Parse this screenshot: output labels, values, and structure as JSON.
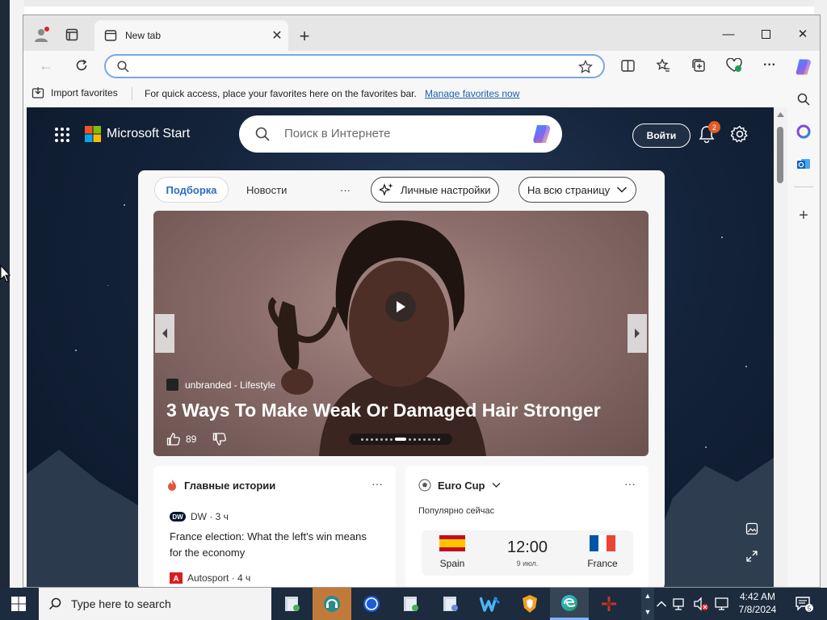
{
  "browser": {
    "tab_title": "New tab",
    "address": {
      "value": "",
      "placeholder": ""
    },
    "favorites_bar": {
      "import_label": "Import favorites",
      "message": "For quick access, place your favorites here on the favorites bar.",
      "manage_link": "Manage favorites now"
    }
  },
  "start_page": {
    "brand": "Microsoft Start",
    "search_placeholder": "Поиск в Интернете",
    "login_label": "Войти",
    "notification_count": "2",
    "feed_tabs": {
      "selected": "Подборка",
      "news": "Новости",
      "more": "···",
      "personalize": "Личные настройки",
      "layout": "На всю страницу"
    },
    "hero": {
      "source": "unbranded - Lifestyle",
      "title": "3 Ways To Make Weak Or Damaged Hair Stronger",
      "likes": "89"
    },
    "top_stories": {
      "heading": "Главные истории",
      "more": "···",
      "story1_source": "DW · 3 ч",
      "story1_source_logo": "DW",
      "story1_title": "France election: What the left's win means for the economy",
      "story2_source": "Autosport · 4 ч",
      "story2_source_logo": "A"
    },
    "euro_cup": {
      "heading": "Euro Cup",
      "more": "···",
      "subheading": "Популярно сейчас",
      "team_home": "Spain",
      "team_away": "France",
      "time": "12:00",
      "date": "9 июл."
    }
  },
  "taskbar": {
    "search_placeholder": "Type here to search",
    "time": "4:42 AM",
    "date": "7/8/2024",
    "notification_count": "5"
  },
  "colors": {
    "accent": "#2b6cc4",
    "address_border": "#7ba6e6",
    "badge": "#e25c23",
    "taskbar": "#1c2b3e"
  }
}
